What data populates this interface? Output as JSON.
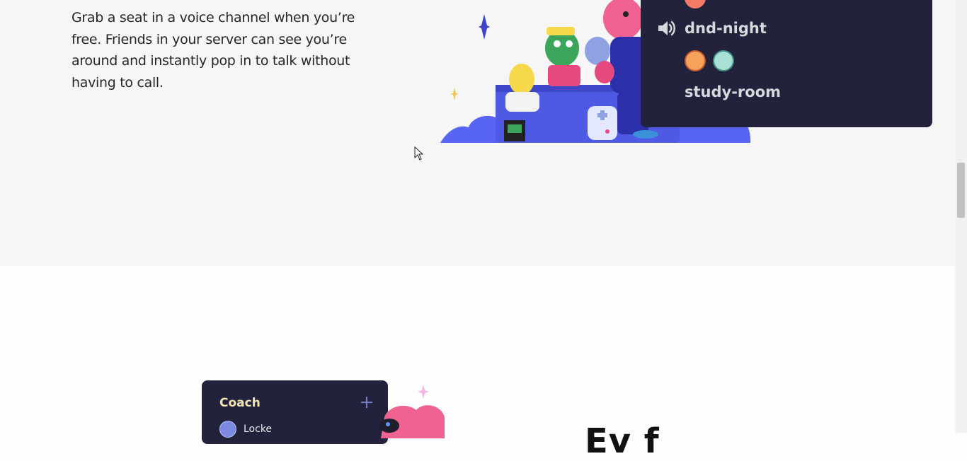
{
  "feature": {
    "body": "Grab a seat in a voice channel when you’re free. Friends in your server can see you’re around and instantly pop in to talk without having to call."
  },
  "voice_panel": {
    "channels": [
      {
        "name": "dnd-night",
        "icon": "speaker-icon",
        "members": 2
      },
      {
        "name": "study-room",
        "icon": "none"
      }
    ]
  },
  "coach_card": {
    "title": "Coach",
    "add_icon": "plus-icon",
    "member": "Locke"
  },
  "next_heading_fragment": "Ev f",
  "colors": {
    "panel_bg": "#23223c",
    "blurple": "#5865f2",
    "section_gray": "#f6f6f6"
  }
}
